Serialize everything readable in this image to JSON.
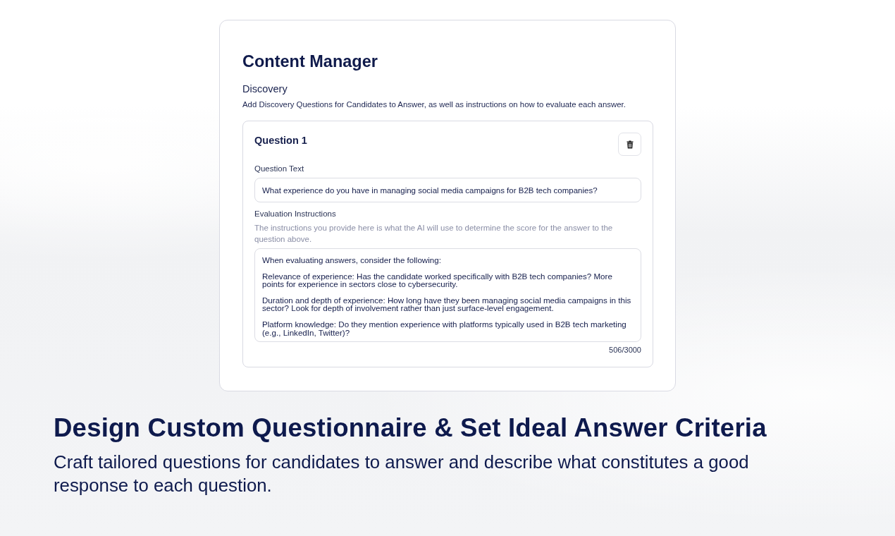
{
  "panel": {
    "title": "Content Manager",
    "section": {
      "title": "Discovery",
      "description": "Add Discovery Questions for Candidates to Answer, as well as instructions on how to evaluate each answer."
    },
    "questions": [
      {
        "title": "Question 1",
        "question_text": {
          "label": "Question Text",
          "value": "What experience do you have in managing social media campaigns for B2B tech companies?"
        },
        "evaluation": {
          "label": "Evaluation Instructions",
          "help": "The instructions you provide here is what the AI will use to determine the score for the answer to the question above.",
          "value": "When evaluating answers, consider the following:\n\nRelevance of experience: Has the candidate worked specifically with B2B tech companies? More points for experience in sectors close to cybersecurity.\n\nDuration and depth of experience: How long have they been managing social media campaigns in this sector? Look for depth of involvement rather than just surface-level engagement.\n\nPlatform knowledge: Do they mention experience with platforms typically used in B2B tech marketing (e.g., LinkedIn, Twitter)?",
          "counter": "506/3000"
        }
      }
    ]
  },
  "hero": {
    "title": "Design Custom Questionnaire & Set Ideal Answer Criteria",
    "subtitle": "Craft tailored questions for candidates to answer and describe what constitutes a good response to each question."
  }
}
